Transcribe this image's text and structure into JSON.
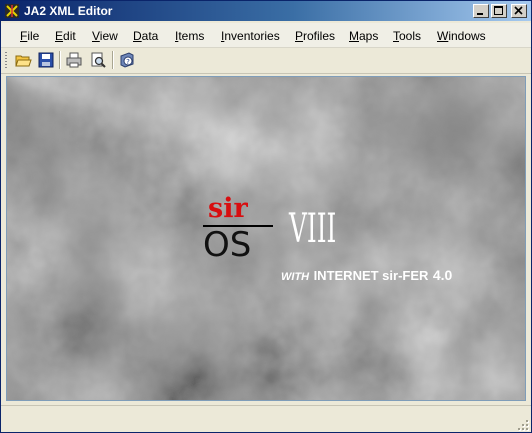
{
  "window": {
    "title": "JA2 XML Editor"
  },
  "title_buttons": {
    "minimize_icon": "minimize-icon",
    "maximize_icon": "maximize-icon",
    "close_icon": "close-icon"
  },
  "menu": [
    {
      "label": "File",
      "mnemonic": "F"
    },
    {
      "label": "Edit",
      "mnemonic": "E"
    },
    {
      "label": "View",
      "mnemonic": "V"
    },
    {
      "label": "Data",
      "mnemonic": "D"
    },
    {
      "label": "Items",
      "mnemonic": "I"
    },
    {
      "label": "Inventories",
      "mnemonic": "I"
    },
    {
      "label": "Profiles",
      "mnemonic": "P"
    },
    {
      "label": "Maps",
      "mnemonic": "M"
    },
    {
      "label": "Tools",
      "mnemonic": "T"
    },
    {
      "label": "Windows",
      "mnemonic": "W"
    }
  ],
  "toolbar": [
    "open-folder-icon",
    "save-icon",
    "print-icon",
    "print-preview-icon",
    "help-icon"
  ],
  "splash": {
    "sir": "sir",
    "os": "OS",
    "version": "VIII",
    "with": "WITH",
    "internet": "INTERNET sir-FER",
    "internet_version": "4.0"
  },
  "colors": {
    "title_start": "#0a246a",
    "title_end": "#a6caf0",
    "sir_red": "#d80e10",
    "client_gray": "#8a8a8a"
  }
}
